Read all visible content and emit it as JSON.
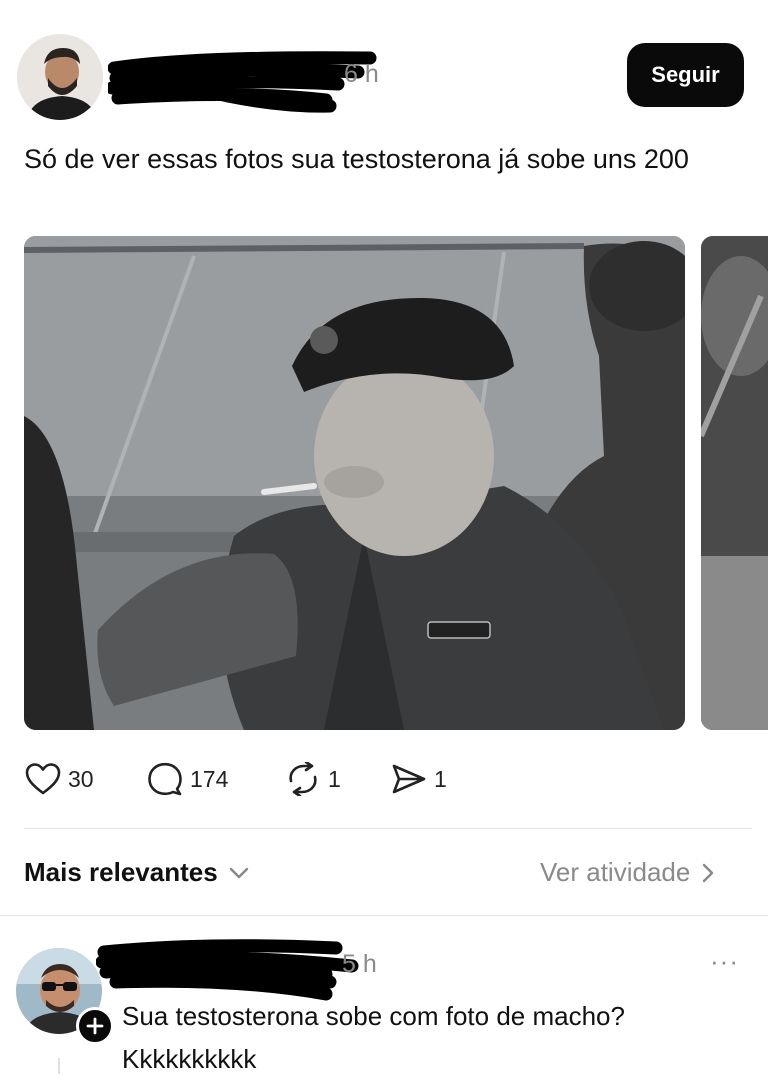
{
  "post": {
    "time": "6 h",
    "follow_label": "Seguir",
    "text": "Só de ver essas fotos sua testosterona já sobe uns 200",
    "likes": "30",
    "comments": "174",
    "reposts": "1",
    "shares": "1"
  },
  "sort": {
    "label": "Mais relevantes",
    "activity_label": "Ver atividade"
  },
  "reply": {
    "time": "5 h",
    "text": "Sua testosterona sobe com foto de macho? Kkkkkkkkkk",
    "more_label": "···"
  },
  "icons": {
    "like": "heart-icon",
    "comment": "comment-bubble-icon",
    "repost": "repost-icon",
    "share": "send-icon",
    "sort_chevron": "chevron-down-icon",
    "activity_chevron": "chevron-right-icon",
    "follow_plus": "plus-icon",
    "more": "more-dots-icon"
  }
}
